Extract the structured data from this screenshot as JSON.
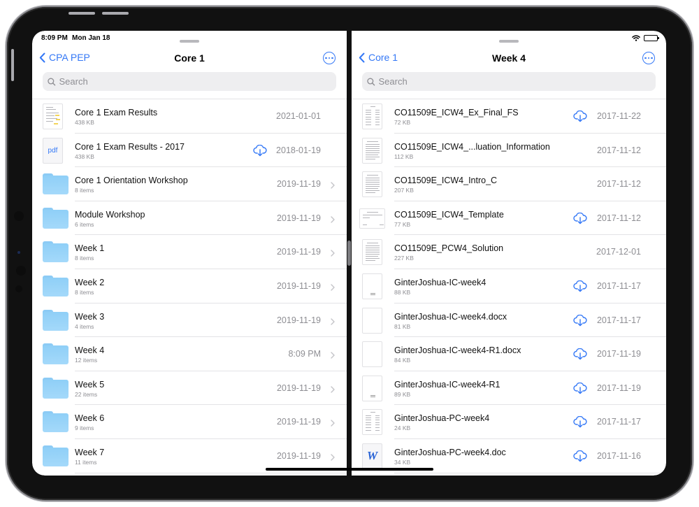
{
  "status_bar": {
    "time": "8:09 PM",
    "date": "Mon Jan 18",
    "wifi_icon": "wifi-icon",
    "battery_icon": "battery-icon"
  },
  "accent_color": "#3478f6",
  "left_pane": {
    "back_label": "CPA PEP",
    "title": "Core 1",
    "search_placeholder": "Search",
    "items": [
      {
        "name": "Core 1 Exam Results",
        "sub": "438 KB",
        "date": "2021-01-01",
        "type": "doc-highlight",
        "cloud": false,
        "chevron": false
      },
      {
        "name": "Core 1 Exam Results - 2017",
        "sub": "438 KB",
        "date": "2018-01-19",
        "type": "pdf",
        "icon_label": "pdf",
        "cloud": true,
        "chevron": false
      },
      {
        "name": "Core 1 Orientation Workshop",
        "sub": "8 items",
        "date": "2019-11-19",
        "type": "folder",
        "cloud": false,
        "chevron": true
      },
      {
        "name": "Module Workshop",
        "sub": "6 items",
        "date": "2019-11-19",
        "type": "folder",
        "cloud": false,
        "chevron": true
      },
      {
        "name": "Week 1",
        "sub": "8 items",
        "date": "2019-11-19",
        "type": "folder",
        "cloud": false,
        "chevron": true
      },
      {
        "name": "Week 2",
        "sub": "8 items",
        "date": "2019-11-19",
        "type": "folder",
        "cloud": false,
        "chevron": true
      },
      {
        "name": "Week 3",
        "sub": "4 items",
        "date": "2019-11-19",
        "type": "folder",
        "cloud": false,
        "chevron": true
      },
      {
        "name": "Week 4",
        "sub": "12 items",
        "date": "8:09 PM",
        "type": "folder",
        "cloud": false,
        "chevron": true
      },
      {
        "name": "Week 5",
        "sub": "22 items",
        "date": "2019-11-19",
        "type": "folder",
        "cloud": false,
        "chevron": true
      },
      {
        "name": "Week 6",
        "sub": "9 items",
        "date": "2019-11-19",
        "type": "folder",
        "cloud": false,
        "chevron": true
      },
      {
        "name": "Week 7",
        "sub": "11 items",
        "date": "2019-11-19",
        "type": "folder",
        "cloud": false,
        "chevron": true
      }
    ]
  },
  "right_pane": {
    "back_label": "Core 1",
    "title": "Week 4",
    "search_placeholder": "Search",
    "items": [
      {
        "name": "CO11509E_ICW4_Ex_Final_FS",
        "sub": "72 KB",
        "date": "2017-11-22",
        "type": "doc-table",
        "cloud": true
      },
      {
        "name": "CO11509E_ICW4_...luation_Information",
        "sub": "112 KB",
        "date": "2017-11-12",
        "type": "doc-text",
        "cloud": false
      },
      {
        "name": "CO11509E_ICW4_Intro_C",
        "sub": "207 KB",
        "date": "2017-11-12",
        "type": "doc-text",
        "cloud": false
      },
      {
        "name": "CO11509E_ICW4_Template",
        "sub": "77 KB",
        "date": "2017-11-12",
        "type": "doc-form",
        "cloud": true
      },
      {
        "name": "CO11509E_PCW4_Solution",
        "sub": "227 KB",
        "date": "2017-12-01",
        "type": "doc-text",
        "cloud": false
      },
      {
        "name": "GinterJoshua-IC-week4",
        "sub": "88 KB",
        "date": "2017-11-17",
        "type": "doc-stamp",
        "cloud": true
      },
      {
        "name": "GinterJoshua-IC-week4.docx",
        "sub": "81 KB",
        "date": "2017-11-17",
        "type": "doc-blank",
        "cloud": true
      },
      {
        "name": "GinterJoshua-IC-week4-R1.docx",
        "sub": "84 KB",
        "date": "2017-11-19",
        "type": "doc-blank",
        "cloud": true
      },
      {
        "name": "GinterJoshua-IC-week4-R1",
        "sub": "89 KB",
        "date": "2017-11-19",
        "type": "doc-stamp",
        "cloud": true
      },
      {
        "name": "GinterJoshua-PC-week4",
        "sub": "24 KB",
        "date": "2017-11-17",
        "type": "doc-table",
        "cloud": true
      },
      {
        "name": "GinterJoshua-PC-week4.doc",
        "sub": "34 KB",
        "date": "2017-11-16",
        "type": "word",
        "icon_label": "W",
        "cloud": true
      }
    ]
  }
}
